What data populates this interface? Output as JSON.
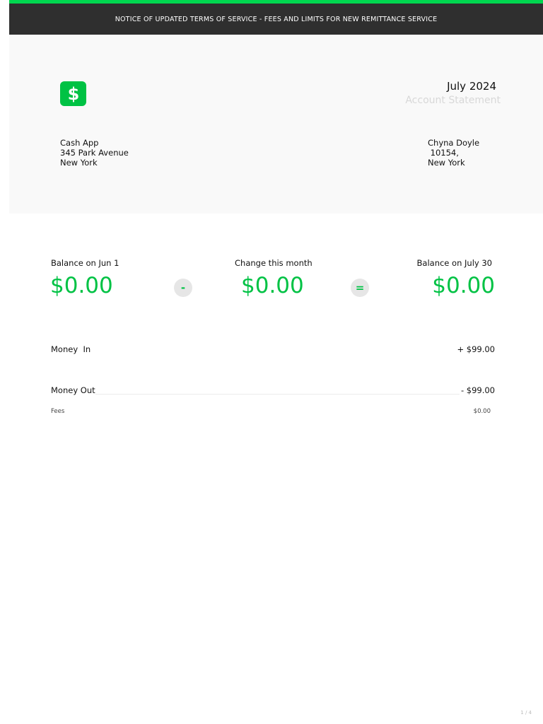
{
  "notice": {
    "text": "NOTICE OF UPDATED TERMS OF SERVICE - FEES AND LIMITS FOR NEW REMITTANCE SERVICE"
  },
  "brand": {
    "logo_icon": "dollar-sign-icon",
    "accent_color": "#00c244",
    "notice_bar_color": "#00d64f"
  },
  "statement": {
    "month": "July 2024",
    "label": "Account Statement"
  },
  "company_address": {
    "line1": "Cash App",
    "line2": "345 Park Avenue",
    "line3": "New York"
  },
  "customer_address": {
    "line1": "Chyna Doyle",
    "line2": " 10154,",
    "line3": "New York"
  },
  "summary": {
    "start_label": "Balance on Jun 1",
    "start_value": "$0.00",
    "minus_symbol": "-",
    "change_label": "Change this month",
    "change_value": "$0.00",
    "equals_symbol": "=",
    "end_label": "Balance on July 30",
    "end_value": "$0.00"
  },
  "rows": {
    "money_in_label": "Money  In",
    "money_in_value": "+ $99.00",
    "money_out_label": "Money Out",
    "money_out_value": "- $99.00",
    "fees_label": "Fees",
    "fees_value": "$0.00"
  },
  "footer": {
    "page_number": "1 / 4"
  }
}
